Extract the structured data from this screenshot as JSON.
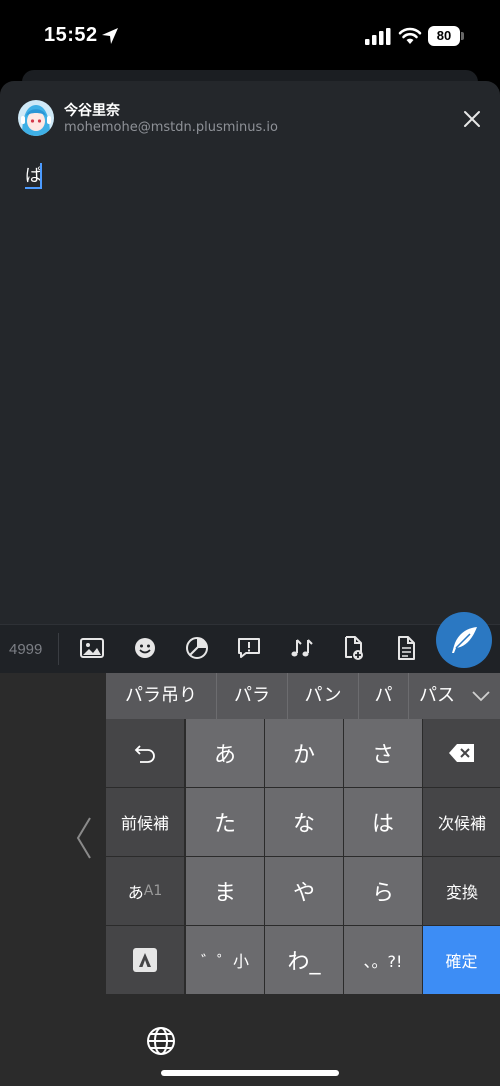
{
  "status_bar": {
    "time": "15:52",
    "battery": "80"
  },
  "compose": {
    "account_name": "今谷里奈",
    "account_handle": "mohemohe@mstdn.plusminus.io",
    "text": "ぱ"
  },
  "toolbar": {
    "char_count": "4999",
    "tools": [
      "image-icon",
      "emoji-icon",
      "nsfw-icon",
      "poll-icon",
      "music-icon",
      "add-file-icon",
      "draft-icon"
    ]
  },
  "keyboard": {
    "candidates": [
      "パラ吊り",
      "パラ",
      "パン",
      "パ",
      "パス"
    ],
    "keys": {
      "kana_a": "あ",
      "kana_ka": "か",
      "kana_sa": "さ",
      "prev_candidate": "前候補",
      "kana_ta": "た",
      "kana_na": "な",
      "kana_ha": "は",
      "next_candidate": "次候補",
      "mode_kana": "あ",
      "mode_alnum": "A1",
      "kana_ma": "ま",
      "kana_ya": "や",
      "kana_ra": "ら",
      "convert": "変換",
      "dakuten": "゛゜小",
      "kana_wa": "わ_",
      "punct": "、。?!",
      "confirm": "確定"
    }
  },
  "colors": {
    "accent": "#2b78c2",
    "confirm_key": "#3d8df5",
    "sheet_bg": "#24272b"
  }
}
